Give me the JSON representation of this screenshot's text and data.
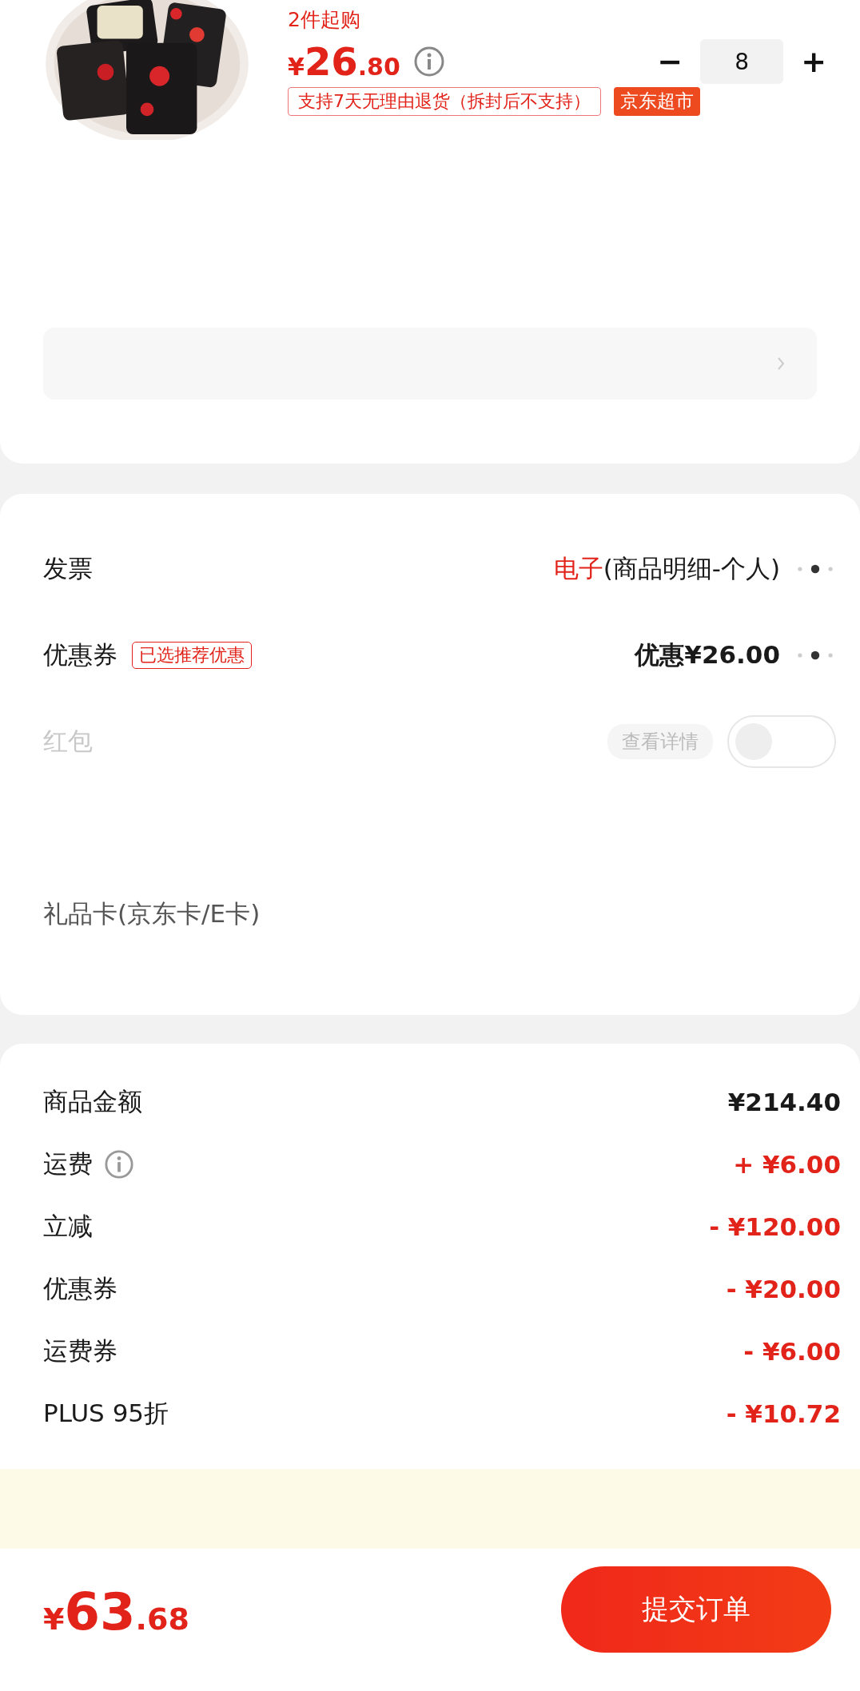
{
  "product": {
    "min_purchase": "2件起购",
    "price_currency": "¥",
    "price_int": "26",
    "price_dec": ".80",
    "quantity": "8",
    "minus": "−",
    "plus": "+",
    "return_policy": "支持7天无理由退货（拆封后不支持）",
    "store_tag": "京东超市"
  },
  "options": [
    {
      "kind": "invoice",
      "label": "发票",
      "value_highlight": "电子",
      "value": "(商品明细-个人)"
    },
    {
      "kind": "coupon",
      "label": "优惠券",
      "badge": "已选推荐优惠",
      "value": "优惠¥26.00"
    },
    {
      "kind": "toggle",
      "label": "红包",
      "button": "查看详情",
      "on": false
    },
    {
      "kind": "blank"
    },
    {
      "kind": "plain",
      "label": "礼品卡(京东卡/E卡)"
    }
  ],
  "summary": [
    {
      "label": "商品金额",
      "amount": "¥214.40",
      "kind": "base"
    },
    {
      "label": "运费",
      "amount": "+ ¥6.00",
      "kind": "charge",
      "info": true
    },
    {
      "label": "立减",
      "amount": "- ¥120.00",
      "kind": "discount"
    },
    {
      "label": "优惠券",
      "amount": "- ¥20.00",
      "kind": "discount"
    },
    {
      "label": "运费券",
      "amount": "- ¥6.00",
      "kind": "discount"
    },
    {
      "label": "PLUS 95折",
      "amount": "- ¥10.72",
      "kind": "discount"
    }
  ],
  "footer": {
    "total_currency": "¥",
    "total_int": "63",
    "total_dec": ".68",
    "submit": "提交订单"
  }
}
